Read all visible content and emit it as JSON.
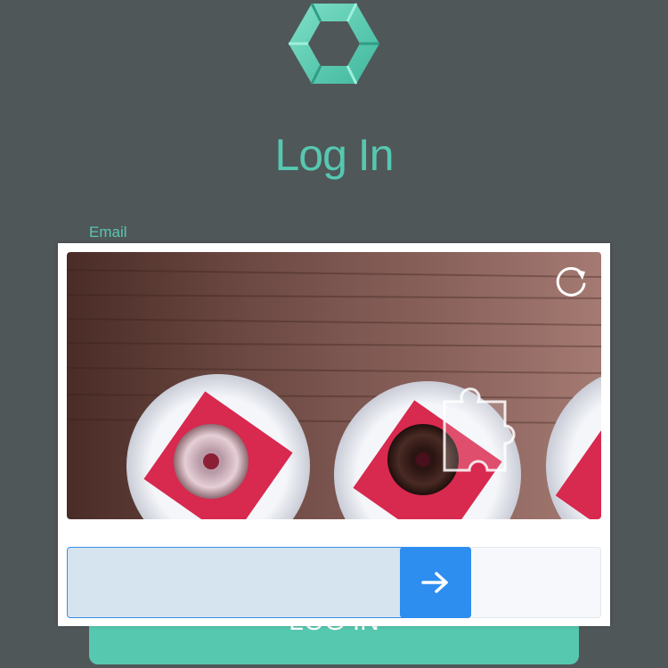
{
  "header": {
    "title": "Log In"
  },
  "logo": {
    "icon": "hexagon-logo-icon",
    "color": "#56c8b0"
  },
  "form": {
    "email_label": "Email",
    "login_button_label": "LOG IN"
  },
  "captcha": {
    "refresh_icon": "refresh-icon",
    "slider_handle_icon": "arrow-right-icon",
    "slider_progress": 0.72,
    "accent_color": "#2d8ef0"
  },
  "colors": {
    "background": "#505759",
    "accent": "#56c8b0",
    "slider": "#2d8ef0"
  }
}
